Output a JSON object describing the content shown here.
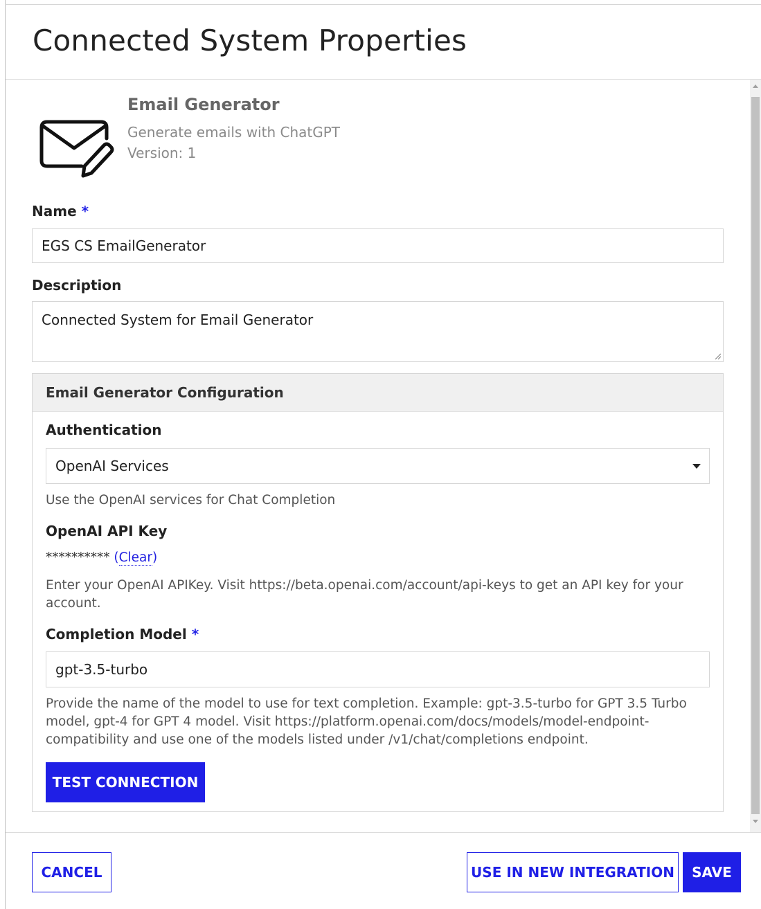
{
  "dialog": {
    "title": "Connected System Properties"
  },
  "plugin": {
    "name": "Email Generator",
    "description": "Generate emails with ChatGPT",
    "version": "Version: 1",
    "icon": "envelope-pencil-icon"
  },
  "form": {
    "name_label": "Name",
    "required_marker": "*",
    "name_value": "EGS CS EmailGenerator",
    "description_label": "Description",
    "description_value": "Connected System for Email Generator"
  },
  "config": {
    "title": "Email Generator Configuration",
    "auth_label": "Authentication",
    "auth_selected": "OpenAI Services",
    "auth_help": "Use the OpenAI services for Chat Completion",
    "api_key_label": "OpenAI API Key",
    "api_key_masked": "**********",
    "clear_open": "(",
    "clear_label": "Clear",
    "clear_close": ")",
    "api_key_help": "Enter your OpenAI APIKey. Visit https://beta.openai.com/account/api-keys to get an API key for your account.",
    "model_label": "Completion Model",
    "model_value": "gpt-3.5-turbo",
    "model_help": "Provide the name of the model to use for text completion. Example: gpt-3.5-turbo for GPT 3.5 Turbo model, gpt-4 for GPT 4 model. Visit https://platform.openai.com/docs/models/model-endpoint-compatibility and use one of the models listed under /v1/chat/completions endpoint.",
    "test_button": "TEST CONNECTION"
  },
  "footer": {
    "cancel": "CANCEL",
    "use_in_new": "USE IN NEW INTEGRATION",
    "save": "SAVE"
  },
  "colors": {
    "accent": "#1f1fe6",
    "border": "#d6d6d6",
    "section_bg": "#f0f0f0"
  }
}
